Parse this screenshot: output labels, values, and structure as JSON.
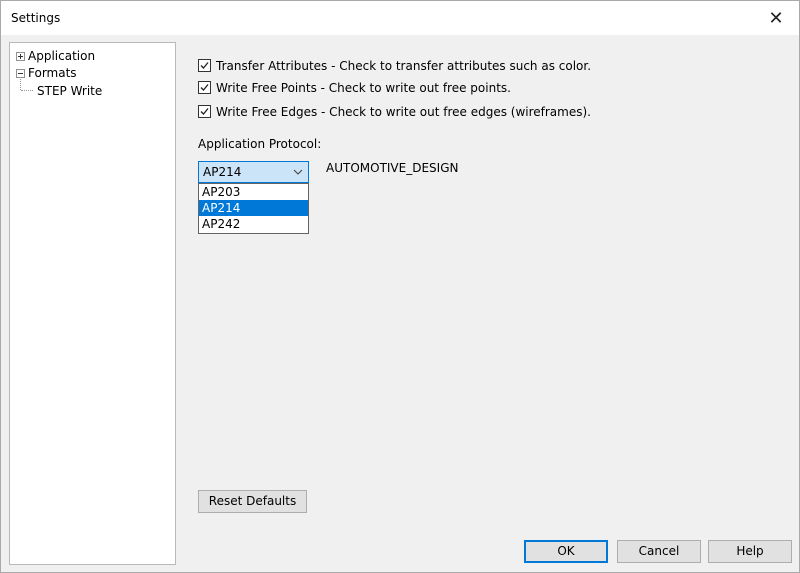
{
  "window": {
    "title": "Settings",
    "close_glyph": "✕"
  },
  "tree": {
    "items": [
      {
        "label": "Application",
        "expander": "plus"
      },
      {
        "label": "Formats",
        "expander": "minus"
      },
      {
        "label": "STEP Write",
        "expander": "none"
      }
    ]
  },
  "options": {
    "transfer_attributes": {
      "label": "Transfer Attributes - Check to transfer attributes such as color.",
      "checked": true
    },
    "write_free_points": {
      "label": "Write Free Points - Check to write out free points.",
      "checked": true
    },
    "write_free_edges": {
      "label": "Write Free Edges - Check to write out free edges (wireframes).",
      "checked": true
    }
  },
  "protocol": {
    "label": "Application Protocol:",
    "selected": "AP214",
    "description": "AUTOMOTIVE_DESIGN",
    "options": [
      "AP203",
      "AP214",
      "AP242"
    ]
  },
  "buttons": {
    "reset": "Reset Defaults",
    "ok": "OK",
    "cancel": "Cancel",
    "help": "Help"
  },
  "icons": {
    "close": "close-icon",
    "check": "check-icon",
    "chevron": "chevron-down-icon",
    "plus": "plus-expander-icon",
    "minus": "minus-expander-icon"
  },
  "colors": {
    "accent": "#0078d7",
    "combo_bg": "#cce4f7",
    "dialog_bg": "#f0f0f0"
  }
}
